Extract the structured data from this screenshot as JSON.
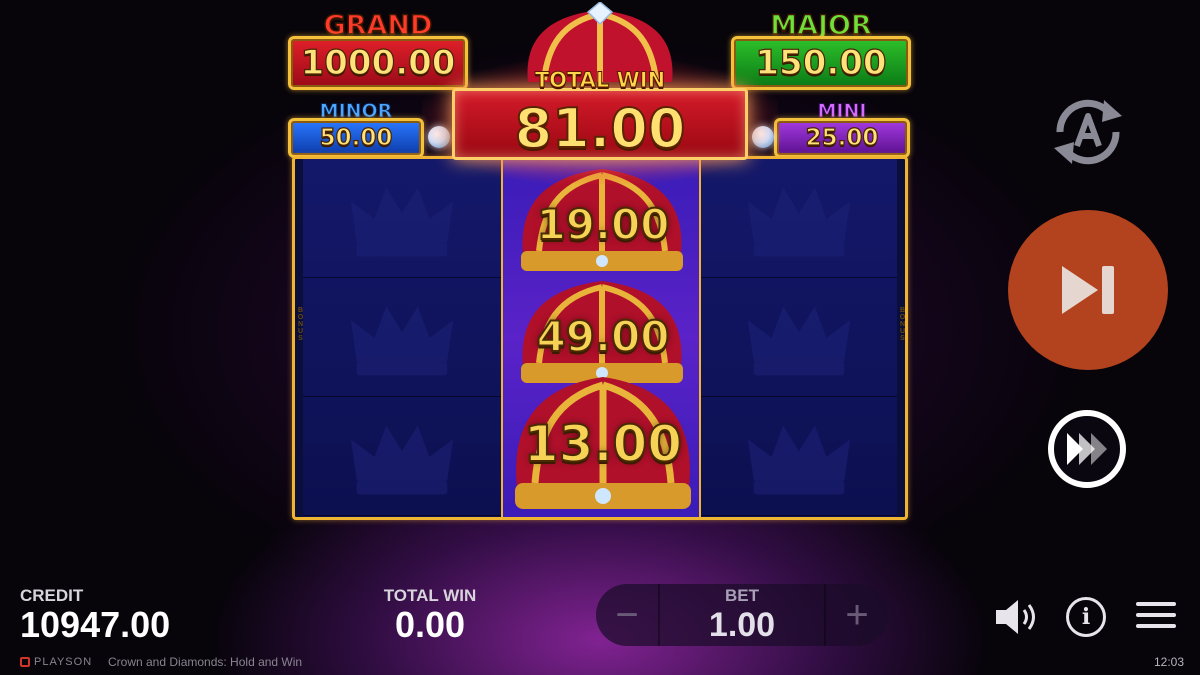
{
  "jackpots": {
    "grand": {
      "title": "GRAND",
      "value": "1000.00"
    },
    "major": {
      "title": "MAJOR",
      "value": "150.00"
    },
    "minor": {
      "title": "MINOR",
      "value": "50.00"
    },
    "mini": {
      "title": "MINI",
      "value": "25.00"
    }
  },
  "total_win_banner": {
    "label": "TOTAL WIN",
    "value": "81.00"
  },
  "reels": {
    "side_label": "BONUS",
    "middle_crowns": [
      "19.00",
      "49.00",
      "13.00"
    ]
  },
  "bottom_bar": {
    "credit_label": "CREDIT",
    "credit_value": "10947.00",
    "total_win_label": "TOTAL WIN",
    "total_win_value": "0.00",
    "bet_label": "BET",
    "bet_value": "1.00",
    "bet_minus": "−",
    "bet_plus": "+"
  },
  "footer": {
    "brand": "PLAYSON",
    "game_title": "Crown and Diamonds: Hold and Win",
    "clock": "12:03"
  },
  "icons": {
    "autoplay": "autoplay-icon",
    "skip": "skip-forward-icon",
    "turbo": "turbo-icon",
    "sound": "speaker-icon",
    "info": "info-icon",
    "menu": "hamburger-menu-icon"
  },
  "colors": {
    "grand": "#e0202a",
    "major": "#2ec02a",
    "minor": "#2a78ff",
    "mini": "#a43ae0",
    "skip_button": "#b3431e",
    "frame_gold": "#f0b433"
  }
}
